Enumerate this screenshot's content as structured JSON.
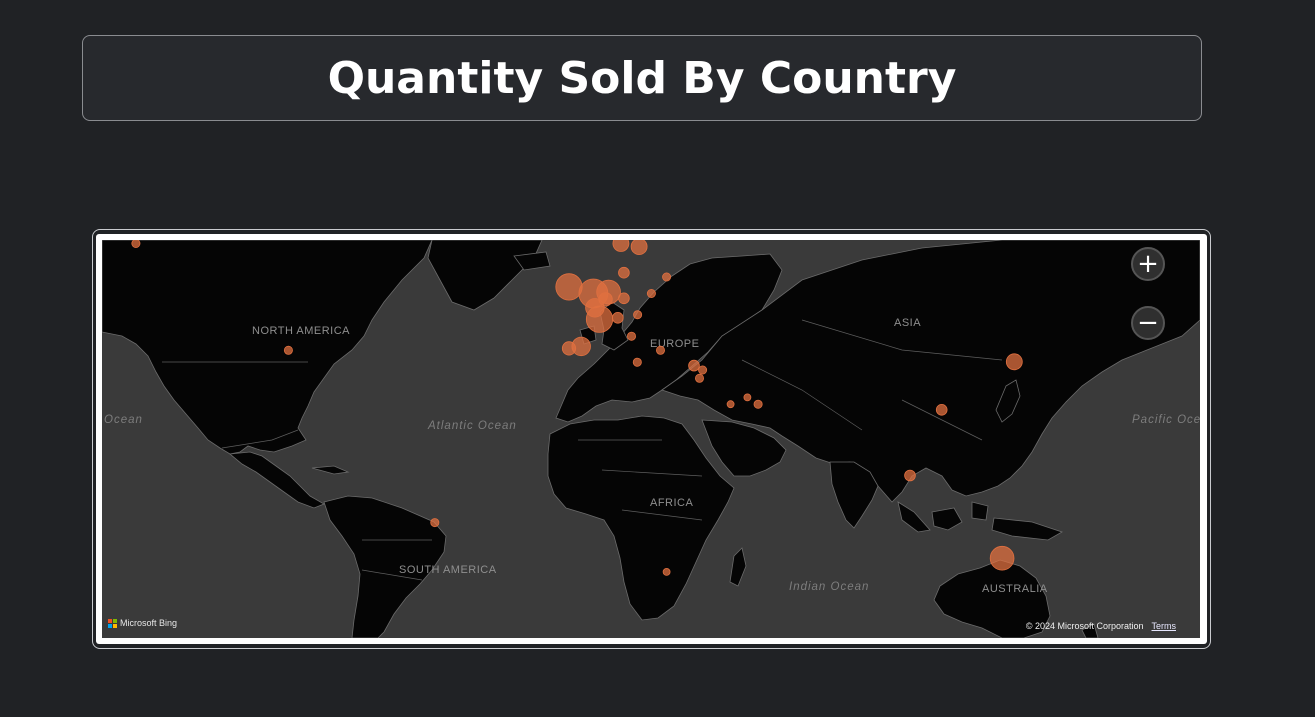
{
  "title": "Quantity Sold By Country",
  "map": {
    "continent_labels": [
      {
        "id": "north-america",
        "text": "NORTH AMERICA"
      },
      {
        "id": "europe",
        "text": "EUROPE"
      },
      {
        "id": "asia",
        "text": "ASIA"
      },
      {
        "id": "africa",
        "text": "AFRICA"
      },
      {
        "id": "south-america",
        "text": "SOUTH AMERICA"
      },
      {
        "id": "australia",
        "text": "AUSTRALIA"
      }
    ],
    "ocean_labels": [
      {
        "id": "atlantic",
        "text": "Atlantic Ocean"
      },
      {
        "id": "indian",
        "text": "Indian Ocean"
      },
      {
        "id": "pacific-left",
        "text": "Ocean"
      },
      {
        "id": "pacific-right",
        "text": "Pacific Oce"
      }
    ],
    "zoom_in_icon": "plus-icon",
    "zoom_out_icon": "minus-icon",
    "attribution": "Microsoft Bing",
    "copyright": "© 2024 Microsoft Corporation",
    "terms": "Terms",
    "bubble_color": "#e07040",
    "bubbles": [
      {
        "place": "Alaska",
        "lat": 61,
        "lon": -150,
        "size": 2
      },
      {
        "place": "United States",
        "lat": 39,
        "lon": -100,
        "size": 2
      },
      {
        "place": "Brazil",
        "lat": -14,
        "lon": -52,
        "size": 2
      },
      {
        "place": "Iceland",
        "lat": 65,
        "lon": -18,
        "size": 3
      },
      {
        "place": "Ireland",
        "lat": 53.3,
        "lon": -8,
        "size": 9
      },
      {
        "place": "United Kingdom",
        "lat": 52,
        "lon": 0,
        "size": 10
      },
      {
        "place": "Netherlands",
        "lat": 52.3,
        "lon": 5,
        "size": 8
      },
      {
        "place": "Belgium",
        "lat": 50.8,
        "lon": 4,
        "size": 4
      },
      {
        "place": "France",
        "lat": 46.5,
        "lon": 2,
        "size": 9
      },
      {
        "place": "Germany",
        "lat": 51,
        "lon": 10,
        "size": 3
      },
      {
        "place": "Switzerland",
        "lat": 46.8,
        "lon": 8,
        "size": 3
      },
      {
        "place": "Channel Islands",
        "lat": 49,
        "lon": 0.5,
        "size": 6
      },
      {
        "place": "Portugal",
        "lat": 39.5,
        "lon": -8,
        "size": 4
      },
      {
        "place": "Spain",
        "lat": 40,
        "lon": -4,
        "size": 6
      },
      {
        "place": "Norway",
        "lat": 61,
        "lon": 9,
        "size": 5
      },
      {
        "place": "Sweden",
        "lat": 60.5,
        "lon": 15,
        "size": 5
      },
      {
        "place": "Finland",
        "lat": 64,
        "lon": 26,
        "size": 3
      },
      {
        "place": "Denmark",
        "lat": 56,
        "lon": 10,
        "size": 3
      },
      {
        "place": "Poland",
        "lat": 52,
        "lon": 19,
        "size": 2
      },
      {
        "place": "Lithuania",
        "lat": 55.2,
        "lon": 24,
        "size": 2
      },
      {
        "place": "Austria",
        "lat": 47.5,
        "lon": 14.5,
        "size": 2
      },
      {
        "place": "Italy",
        "lat": 42.5,
        "lon": 12.5,
        "size": 2
      },
      {
        "place": "Greece",
        "lat": 39,
        "lon": 22,
        "size": 2
      },
      {
        "place": "Malta",
        "lat": 35.9,
        "lon": 14.4,
        "size": 2
      },
      {
        "place": "Cyprus",
        "lat": 35,
        "lon": 33,
        "size": 3
      },
      {
        "place": "Lebanon",
        "lat": 33.8,
        "lon": 35.8,
        "size": 2
      },
      {
        "place": "Israel",
        "lat": 31.5,
        "lon": 34.8,
        "size": 2
      },
      {
        "place": "Saudi Arabia",
        "lat": 24,
        "lon": 45,
        "size": 1.5
      },
      {
        "place": "Bahrain",
        "lat": 26,
        "lon": 50.5,
        "size": 1.5
      },
      {
        "place": "United Arab Emirates",
        "lat": 24,
        "lon": 54,
        "size": 2
      },
      {
        "place": "Japan",
        "lat": 36,
        "lon": 138,
        "size": 5
      },
      {
        "place": "Hong Kong",
        "lat": 22.3,
        "lon": 114.2,
        "size": 3
      },
      {
        "place": "Singapore",
        "lat": 1.3,
        "lon": 103.8,
        "size": 3
      },
      {
        "place": "South Africa",
        "lat": -29,
        "lon": 24,
        "size": 1.5
      },
      {
        "place": "Australia",
        "lat": -25,
        "lon": 134,
        "size": 8
      }
    ]
  }
}
